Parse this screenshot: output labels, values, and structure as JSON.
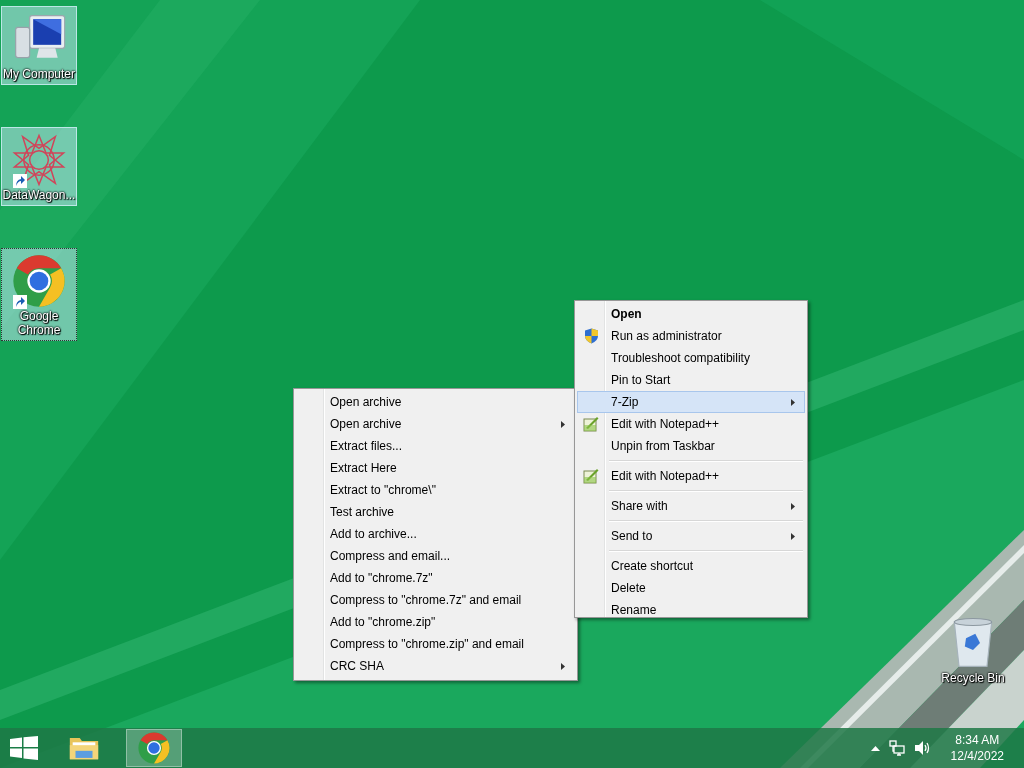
{
  "desktop_icons": [
    {
      "label": "My Computer",
      "kind": "computer",
      "shortcut": false,
      "selected": true,
      "focused": false
    },
    {
      "label": "DataWagon...",
      "kind": "star",
      "shortcut": true,
      "selected": true,
      "focused": false
    },
    {
      "label": "Google Chrome",
      "kind": "chrome",
      "shortcut": true,
      "selected": true,
      "focused": true
    },
    {
      "label": "Recycle Bin",
      "kind": "bin",
      "shortcut": false,
      "selected": false,
      "focused": false
    }
  ],
  "context_menu": {
    "items": [
      {
        "kind": "plain",
        "label": "Open",
        "default": true,
        "submenu": false,
        "selected": false
      },
      {
        "kind": "shield",
        "label": "Run as administrator",
        "default": false,
        "submenu": false,
        "selected": false
      },
      {
        "kind": "plain",
        "label": "Troubleshoot compatibility",
        "default": false,
        "submenu": false,
        "selected": false
      },
      {
        "kind": "plain",
        "label": "Pin to Start",
        "default": false,
        "submenu": false,
        "selected": false
      },
      {
        "kind": "plain",
        "label": "7-Zip",
        "default": false,
        "submenu": true,
        "selected": true
      },
      {
        "kind": "notepad",
        "label": "Edit with Notepad++",
        "default": false,
        "submenu": false,
        "selected": false
      },
      {
        "kind": "plain",
        "label": "Unpin from Taskbar",
        "default": false,
        "submenu": false,
        "selected": false
      },
      {
        "kind": "separator"
      },
      {
        "kind": "notepad",
        "label": "Edit with Notepad++",
        "default": false,
        "submenu": false,
        "selected": false
      },
      {
        "kind": "separator"
      },
      {
        "kind": "plain",
        "label": "Share with",
        "default": false,
        "submenu": true,
        "selected": false
      },
      {
        "kind": "separator"
      },
      {
        "kind": "plain",
        "label": "Send to",
        "default": false,
        "submenu": true,
        "selected": false
      },
      {
        "kind": "separator"
      },
      {
        "kind": "plain",
        "label": "Create shortcut",
        "default": false,
        "submenu": false,
        "selected": false
      },
      {
        "kind": "plain",
        "label": "Delete",
        "default": false,
        "submenu": false,
        "selected": false
      },
      {
        "kind": "plain",
        "label": "Rename",
        "default": false,
        "submenu": false,
        "selected": false
      }
    ]
  },
  "submenu": {
    "items": [
      {
        "kind": "plain",
        "label": "Open archive",
        "submenu": false,
        "selected": false
      },
      {
        "kind": "plain",
        "label": "Open archive",
        "submenu": true,
        "selected": false
      },
      {
        "kind": "plain",
        "label": "Extract files...",
        "submenu": false,
        "selected": false
      },
      {
        "kind": "plain",
        "label": "Extract Here",
        "submenu": false,
        "selected": false
      },
      {
        "kind": "plain",
        "label": "Extract to \"chrome\\\"",
        "submenu": false,
        "selected": false
      },
      {
        "kind": "plain",
        "label": "Test archive",
        "submenu": false,
        "selected": false
      },
      {
        "kind": "plain",
        "label": "Add to archive...",
        "submenu": false,
        "selected": false
      },
      {
        "kind": "plain",
        "label": "Compress and email...",
        "submenu": false,
        "selected": false
      },
      {
        "kind": "plain",
        "label": "Add to \"chrome.7z\"",
        "submenu": false,
        "selected": false
      },
      {
        "kind": "plain",
        "label": "Compress to \"chrome.7z\" and email",
        "submenu": false,
        "selected": false
      },
      {
        "kind": "plain",
        "label": "Add to \"chrome.zip\"",
        "submenu": false,
        "selected": false
      },
      {
        "kind": "plain",
        "label": "Compress to \"chrome.zip\" and email",
        "submenu": false,
        "selected": false
      },
      {
        "kind": "plain",
        "label": "CRC SHA",
        "submenu": true,
        "selected": false
      }
    ]
  },
  "taskbar": {
    "apps": [
      {
        "kind": "folder",
        "active": false
      },
      {
        "kind": "chrome",
        "active": true
      }
    ],
    "clock": {
      "time": "8:34 AM",
      "date": "12/4/2022"
    }
  }
}
